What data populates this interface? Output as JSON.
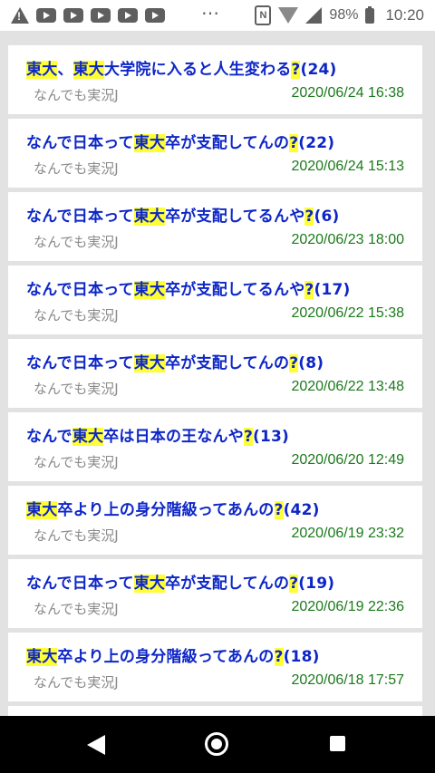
{
  "status_bar": {
    "battery_percent": "98%",
    "time": "10:20",
    "icons": [
      "warning-icon",
      "youtube-icon",
      "youtube-icon",
      "youtube-icon",
      "youtube-icon",
      "youtube-icon",
      "more-dots-icon",
      "nfc-icon",
      "wifi-icon",
      "signal-icon",
      "battery-icon"
    ]
  },
  "colors": {
    "title": "#0d26c8",
    "highlight": "#ffff33",
    "board": "#8a8a8a",
    "date": "#1a7a1a",
    "background": "#e2e2e2"
  },
  "threads": [
    {
      "title_parts": [
        {
          "t": "東大",
          "hl": true
        },
        {
          "t": "、",
          "hl": false
        },
        {
          "t": "東大",
          "hl": true
        },
        {
          "t": "大学院に入ると人生変わる",
          "hl": false
        },
        {
          "t": "?",
          "hl": true
        },
        {
          "t": "(24)",
          "hl": false
        }
      ],
      "board": "なんでも実況J",
      "date": "2020/06/24 16:38"
    },
    {
      "title_parts": [
        {
          "t": "なんで日本って",
          "hl": false
        },
        {
          "t": "東大",
          "hl": true
        },
        {
          "t": "卒が支配してんの",
          "hl": false
        },
        {
          "t": "?",
          "hl": true
        },
        {
          "t": "(22)",
          "hl": false
        }
      ],
      "board": "なんでも実況J",
      "date": "2020/06/24 15:13"
    },
    {
      "title_parts": [
        {
          "t": "なんで日本って",
          "hl": false
        },
        {
          "t": "東大",
          "hl": true
        },
        {
          "t": "卒が支配してるんや",
          "hl": false
        },
        {
          "t": "?",
          "hl": true
        },
        {
          "t": "(6)",
          "hl": false
        }
      ],
      "board": "なんでも実況J",
      "date": "2020/06/23 18:00"
    },
    {
      "title_parts": [
        {
          "t": "なんで日本って",
          "hl": false
        },
        {
          "t": "東大",
          "hl": true
        },
        {
          "t": "卒が支配してるんや",
          "hl": false
        },
        {
          "t": "?",
          "hl": true
        },
        {
          "t": "(17)",
          "hl": false
        }
      ],
      "board": "なんでも実況J",
      "date": "2020/06/22 15:38"
    },
    {
      "title_parts": [
        {
          "t": "なんで日本って",
          "hl": false
        },
        {
          "t": "東大",
          "hl": true
        },
        {
          "t": "卒が支配してんの",
          "hl": false
        },
        {
          "t": "?",
          "hl": true
        },
        {
          "t": "(8)",
          "hl": false
        }
      ],
      "board": "なんでも実況J",
      "date": "2020/06/22 13:48"
    },
    {
      "title_parts": [
        {
          "t": "なんで",
          "hl": false
        },
        {
          "t": "東大",
          "hl": true
        },
        {
          "t": "卒は日本の王なんや",
          "hl": false
        },
        {
          "t": "?",
          "hl": true
        },
        {
          "t": "(13)",
          "hl": false
        }
      ],
      "board": "なんでも実況J",
      "date": "2020/06/20 12:49"
    },
    {
      "title_parts": [
        {
          "t": "東大",
          "hl": true
        },
        {
          "t": "卒より上の身分階級ってあんの",
          "hl": false
        },
        {
          "t": "?",
          "hl": true
        },
        {
          "t": "(42)",
          "hl": false
        }
      ],
      "board": "なんでも実況J",
      "date": "2020/06/19 23:32"
    },
    {
      "title_parts": [
        {
          "t": "なんで日本って",
          "hl": false
        },
        {
          "t": "東大",
          "hl": true
        },
        {
          "t": "卒が支配してんの",
          "hl": false
        },
        {
          "t": "?",
          "hl": true
        },
        {
          "t": "(19)",
          "hl": false
        }
      ],
      "board": "なんでも実況J",
      "date": "2020/06/19 22:36"
    },
    {
      "title_parts": [
        {
          "t": "東大",
          "hl": true
        },
        {
          "t": "卒より上の身分階級ってあんの",
          "hl": false
        },
        {
          "t": "?",
          "hl": true
        },
        {
          "t": "(18)",
          "hl": false
        }
      ],
      "board": "なんでも実況J",
      "date": "2020/06/18 17:57"
    }
  ],
  "nav_bar": {
    "icons": [
      "back-icon",
      "home-icon",
      "recent-apps-icon"
    ]
  }
}
